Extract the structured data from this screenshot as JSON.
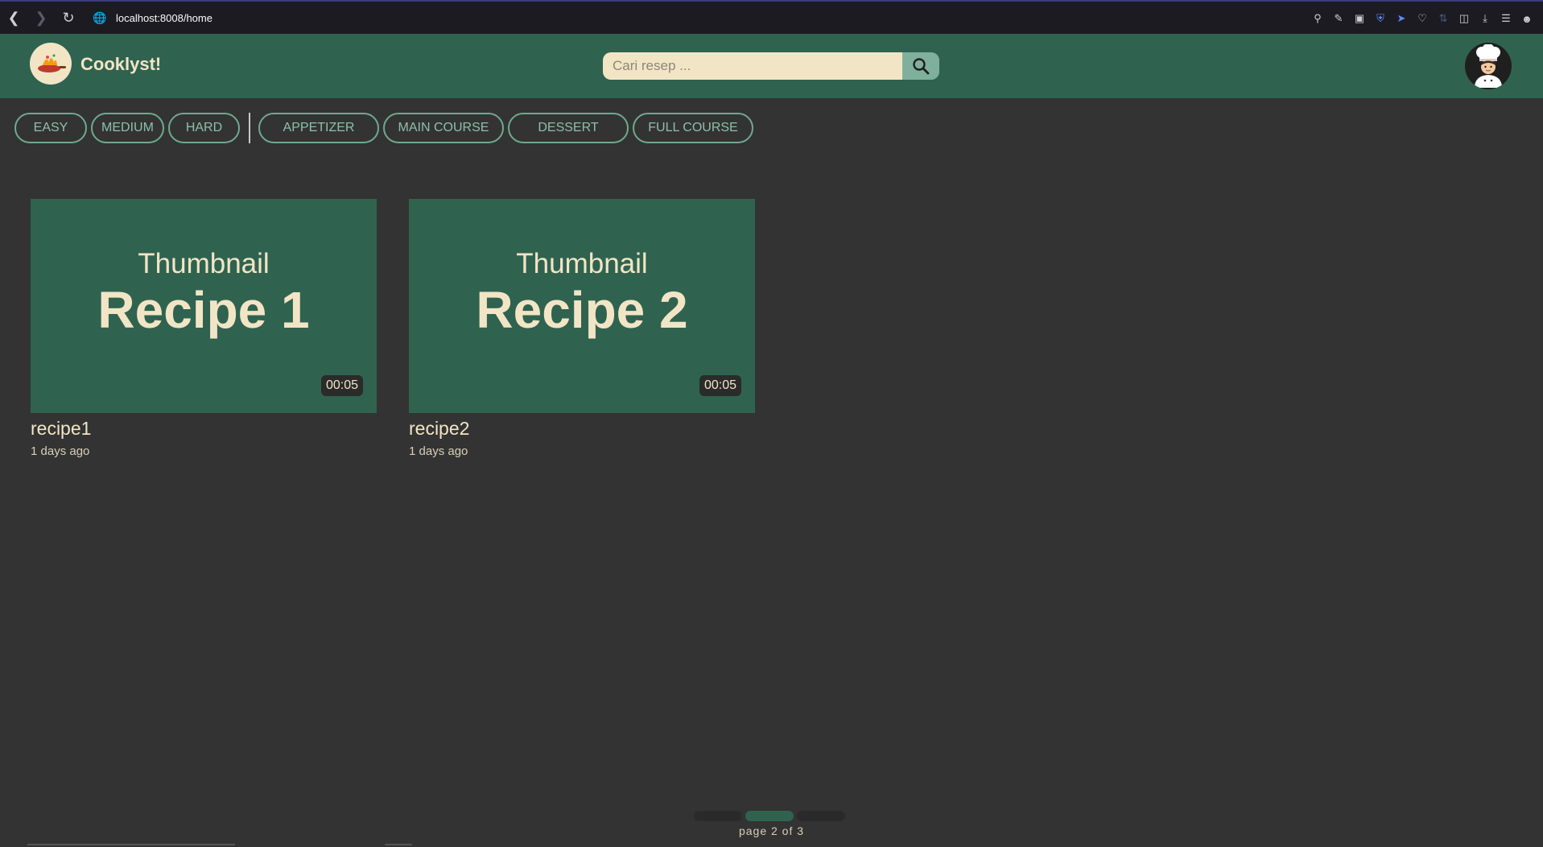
{
  "browser": {
    "url": "localhost:8008/home"
  },
  "header": {
    "brand": "Cooklyst!",
    "search_placeholder": "Cari resep ..."
  },
  "filters": {
    "difficulty": [
      "EASY",
      "MEDIUM",
      "HARD"
    ],
    "course": [
      "APPETIZER",
      "MAIN COURSE",
      "DESSERT",
      "FULL COURSE"
    ]
  },
  "recipes": [
    {
      "thumb_small": "Thumbnail",
      "thumb_big": "Recipe 1",
      "duration": "00:05",
      "title": "recipe1",
      "date": "1 days ago"
    },
    {
      "thumb_small": "Thumbnail",
      "thumb_big": "Recipe 2",
      "duration": "00:05",
      "title": "recipe2",
      "date": "1 days ago"
    }
  ],
  "pagination": {
    "label": "page 2 of 3",
    "current": 2,
    "total": 3
  },
  "colors": {
    "header_bg": "#2f6350",
    "page_bg": "#333333",
    "cream": "#f2e5c6",
    "pill_border": "#6fa992"
  }
}
